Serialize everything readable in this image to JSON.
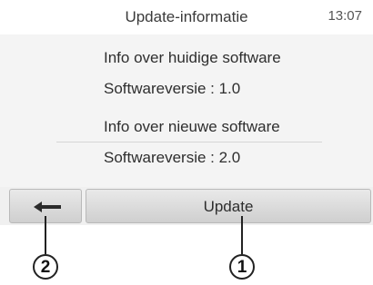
{
  "header": {
    "title": "Update-informatie",
    "clock": "13:07"
  },
  "current": {
    "heading": "Info over huidige software",
    "version": "Softwareversie : 1.0"
  },
  "new": {
    "heading": "Info over nieuwe software",
    "version": "Softwareversie : 2.0"
  },
  "buttons": {
    "back_icon": "back-arrow-icon",
    "update_label": "Update"
  },
  "callouts": {
    "one": "1",
    "two": "2"
  }
}
